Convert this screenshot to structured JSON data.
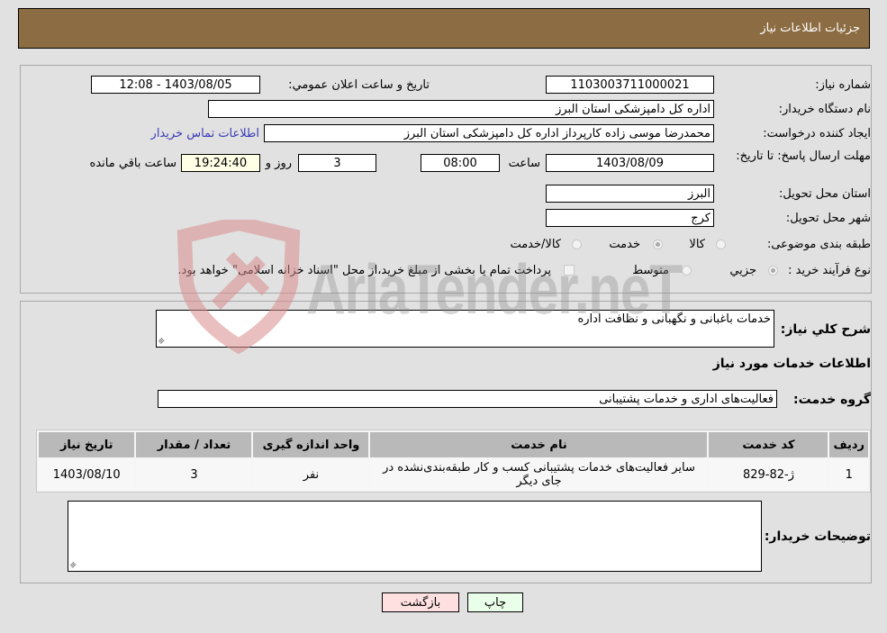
{
  "header": {
    "title": "جزئیات اطلاعات نیاز"
  },
  "form": {
    "need_number": {
      "label": "شماره نیاز:",
      "value": "1103003711000021"
    },
    "announce_datetime": {
      "label": "تاریخ و ساعت اعلان عمومي:",
      "value": "1403/08/05 - 12:08"
    },
    "buyer_org": {
      "label": "نام دستگاه خريدار:",
      "value": "اداره کل دامپزشکی استان البرز"
    },
    "requester": {
      "label": "ایجاد کننده درخواست:",
      "value": "محمدرضا موسی زاده کارپرداز اداره کل دامپزشکی استان البرز",
      "contact_link": "اطلاعات تماس خریدار"
    },
    "deadline": {
      "label": "مهلت ارسال پاسخ: تا تاریخ:",
      "date": "1403/08/09",
      "time_label": "ساعت",
      "time": "08:00",
      "days": "3",
      "days_label": "روز و",
      "remaining": "19:24:40",
      "remaining_label": "ساعت باقي مانده"
    },
    "delivery_province": {
      "label": "استان محل تحویل:",
      "value": "البرز"
    },
    "delivery_city": {
      "label": "شهر محل تحویل:",
      "value": "کرج"
    },
    "category": {
      "label": "طبقه بندی موضوعی:",
      "options": [
        "کالا",
        "خدمت",
        "کالا/خدمت"
      ],
      "selected": "خدمت"
    },
    "purchase_type": {
      "label": "نوع فرآیند خرید :",
      "options": [
        "جزيي",
        "متوسط"
      ],
      "selected": "جزيي",
      "treasury_checkbox_label": "پرداخت تمام یا بخشی از مبلغ خرید،از محل \"اسناد خزانه اسلامی\" خواهد بود.",
      "treasury_checked": false
    }
  },
  "details": {
    "description_label": "شرح کلي نياز:",
    "description_value": "خدمات باغبانی و نگهبانی و نظافت اداره",
    "services_heading": "اطلاعات خدمات مورد نیاز",
    "service_group_label": "گروه خدمت:",
    "service_group_value": "فعالیت‌های اداری و خدمات پشتیبانی",
    "table": {
      "headers": [
        "ردیف",
        "کد خدمت",
        "نام خدمت",
        "واحد اندازه گیری",
        "تعداد / مقدار",
        "تاریخ نیاز"
      ],
      "rows": [
        {
          "row": "1",
          "code": "ژ-82-829",
          "name": "سایر فعالیت‌های خدمات پشتیبانی کسب و کار طبقه‌بندی‌نشده در جای دیگر",
          "unit": "نفر",
          "qty": "3",
          "date": "1403/08/10"
        }
      ]
    },
    "buyer_notes_label": "توضیحات خریدار:",
    "buyer_notes_value": ""
  },
  "buttons": {
    "print": "چاپ",
    "back": "بازگشت"
  },
  "watermark": {
    "text": "AriaTender.neT"
  },
  "colors": {
    "header_bg": "#8c6c42",
    "print_bg": "#eaffea",
    "back_bg": "#ffe0e0",
    "link": "#3a3ab8"
  }
}
